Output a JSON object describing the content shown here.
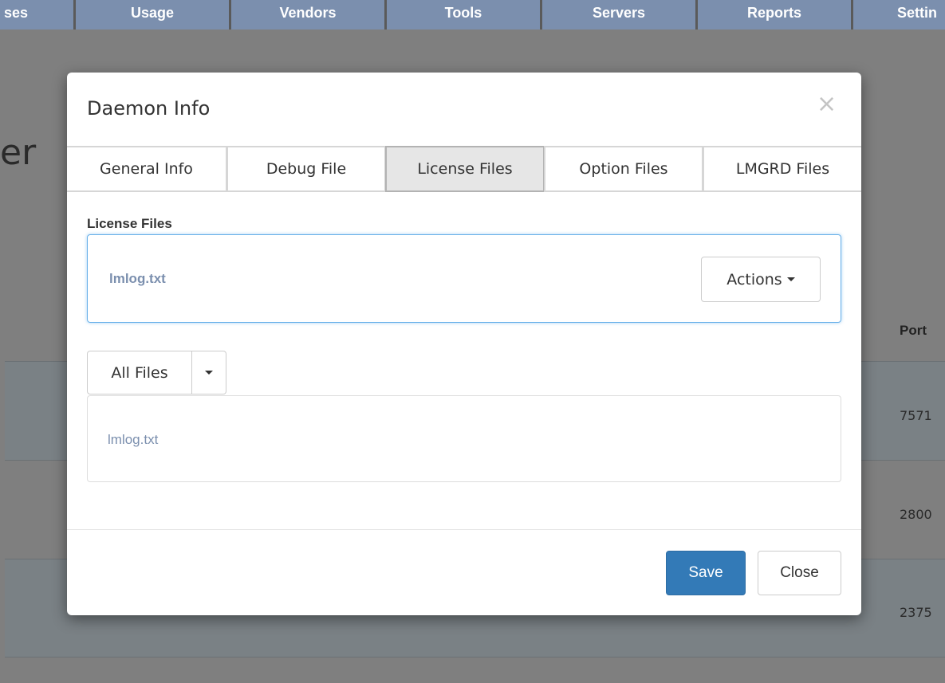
{
  "nav": {
    "tabs": [
      "ses",
      "Usage",
      "Vendors",
      "Tools",
      "Servers",
      "Reports",
      "Settin"
    ]
  },
  "background": {
    "page_title": "er",
    "table_header": "Port",
    "ports": [
      "7571",
      "2800",
      "2375"
    ]
  },
  "modal": {
    "title": "Daemon Info",
    "close_icon": "×",
    "tabs": [
      "General Info",
      "Debug File",
      "License Files",
      "Option Files",
      "LMGRD Files"
    ],
    "active_tab": "License Files",
    "section_label": "License Files",
    "selected_file": "lmlog.txt",
    "actions_label": "Actions",
    "filter_label": "All Files",
    "files": [
      "lmlog.txt"
    ],
    "save_label": "Save",
    "close_label": "Close"
  },
  "colors": {
    "nav_bg": "#7b8fae",
    "overlay": "#7f7f7f",
    "primary": "#337ab7",
    "link": "#7b8fae",
    "focus_border": "#66afe9"
  },
  "icons": {
    "close": "close-icon",
    "caret": "caret-down-icon"
  }
}
